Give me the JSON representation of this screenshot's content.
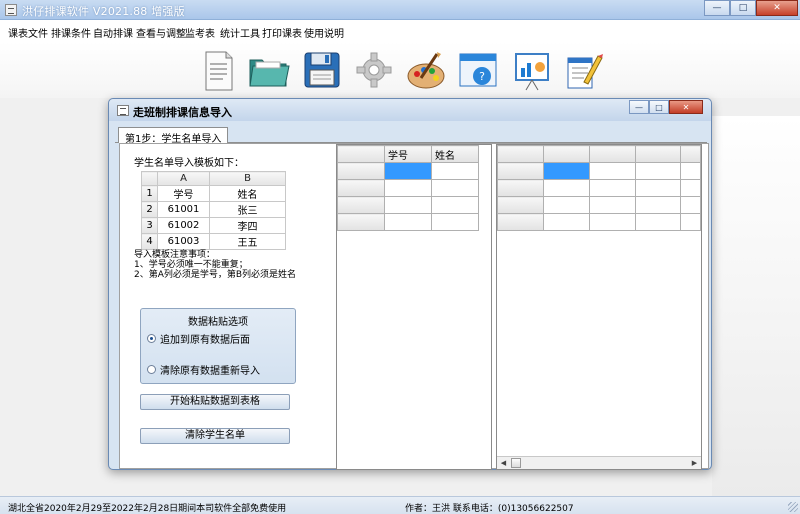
{
  "app": {
    "title": "洪仔排课软件 V2021.88 增强版"
  },
  "menu": [
    "课表文件",
    "排课条件",
    "自动排课",
    "查看与调整",
    "监考表",
    "统计工具",
    "打印课表",
    "使用说明"
  ],
  "toolbar": {
    "icons": [
      "document-icon",
      "folder-icon",
      "floppy-disk-icon",
      "gear-icon",
      "palette-icon",
      "help-window-icon",
      "chart-board-icon",
      "notepad-pencil-icon"
    ]
  },
  "dialog": {
    "title": "走班制排课信息导入",
    "tab": "第1步：学生名单导入",
    "template_label": "学生名单导入模板如下：",
    "sample": {
      "col_headers": [
        "A",
        "B"
      ],
      "rows": [
        {
          "num": "1",
          "a": "学号",
          "b": "姓名"
        },
        {
          "num": "2",
          "a": "61001",
          "b": "张三"
        },
        {
          "num": "3",
          "a": "61002",
          "b": "李四"
        },
        {
          "num": "4",
          "a": "61003",
          "b": "王五"
        }
      ]
    },
    "notes": [
      "导入模板注意事项：",
      "1、学号必须唯一不能重复；",
      "2、第A列必须是学号，第B列必须是姓名"
    ],
    "paste_group": {
      "title": "数据粘贴选项",
      "option_append": "追加到原有数据后面",
      "option_replace": "清除原有数据重新导入",
      "selected": "append"
    },
    "btn_paste": "开始粘贴数据到表格",
    "btn_clear": "清除学生名单",
    "grid_left": {
      "headers": [
        "学号",
        "姓名"
      ]
    }
  },
  "status": {
    "left": "湖北全省2020年2月29至2022年2月28日期间本司软件全部免费使用",
    "right": "作者：王洪  联系电话：(0)13056622507"
  },
  "colors": {
    "selection": "#3399ff",
    "dialog_bg": "#d7e4f2",
    "title_gradient_top": "#c9dcf2"
  }
}
